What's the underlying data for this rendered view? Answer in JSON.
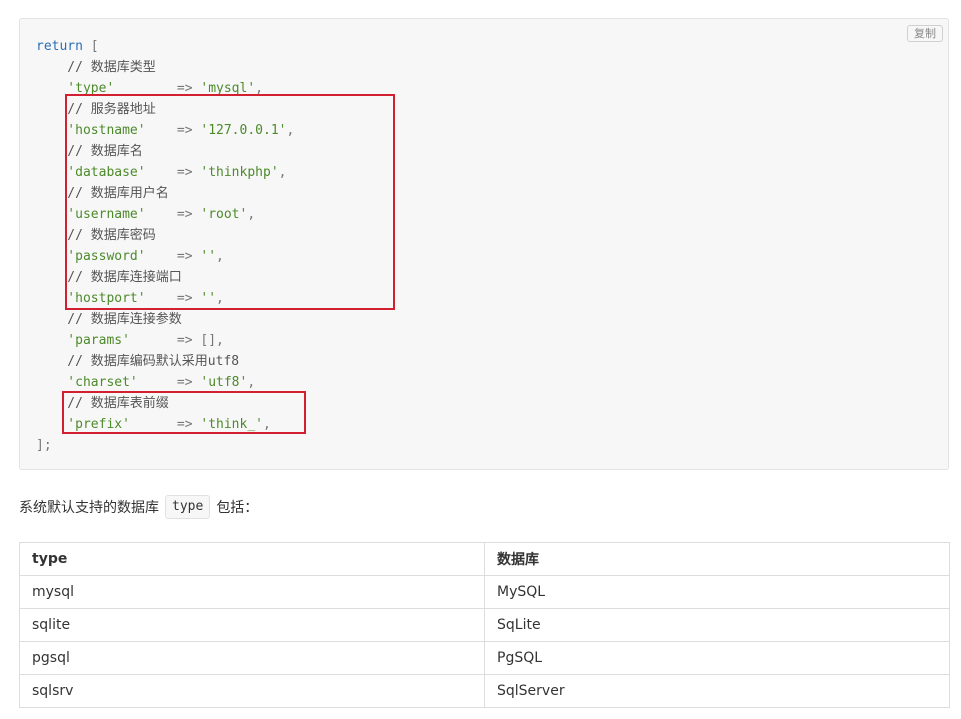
{
  "code_block": {
    "copy_label": "复制",
    "lines": [
      [
        {
          "c": "kw",
          "t": "return"
        },
        {
          "c": "pn",
          "t": " ["
        }
      ],
      [
        {
          "c": "cm",
          "t": "    // 数据库类型"
        }
      ],
      [
        {
          "c": "st",
          "t": "    'type'"
        },
        {
          "c": "pn",
          "t": "        => "
        },
        {
          "c": "st",
          "t": "'mysql'"
        },
        {
          "c": "pn",
          "t": ","
        }
      ],
      [
        {
          "c": "cm",
          "t": "    // 服务器地址"
        }
      ],
      [
        {
          "c": "st",
          "t": "    'hostname'"
        },
        {
          "c": "pn",
          "t": "    => "
        },
        {
          "c": "st",
          "t": "'127.0.0.1'"
        },
        {
          "c": "pn",
          "t": ","
        }
      ],
      [
        {
          "c": "cm",
          "t": "    // 数据库名"
        }
      ],
      [
        {
          "c": "st",
          "t": "    'database'"
        },
        {
          "c": "pn",
          "t": "    => "
        },
        {
          "c": "st",
          "t": "'thinkphp'"
        },
        {
          "c": "pn",
          "t": ","
        }
      ],
      [
        {
          "c": "cm",
          "t": "    // 数据库用户名"
        }
      ],
      [
        {
          "c": "st",
          "t": "    'username'"
        },
        {
          "c": "pn",
          "t": "    => "
        },
        {
          "c": "st",
          "t": "'root'"
        },
        {
          "c": "pn",
          "t": ","
        }
      ],
      [
        {
          "c": "cm",
          "t": "    // 数据库密码"
        }
      ],
      [
        {
          "c": "st",
          "t": "    'password'"
        },
        {
          "c": "pn",
          "t": "    => "
        },
        {
          "c": "st",
          "t": "''"
        },
        {
          "c": "pn",
          "t": ","
        }
      ],
      [
        {
          "c": "cm",
          "t": "    // 数据库连接端口"
        }
      ],
      [
        {
          "c": "st",
          "t": "    'hostport'"
        },
        {
          "c": "pn",
          "t": "    => "
        },
        {
          "c": "st",
          "t": "''"
        },
        {
          "c": "pn",
          "t": ","
        }
      ],
      [
        {
          "c": "cm",
          "t": "    // 数据库连接参数"
        }
      ],
      [
        {
          "c": "st",
          "t": "    'params'"
        },
        {
          "c": "pn",
          "t": "      => [],"
        }
      ],
      [
        {
          "c": "cm",
          "t": "    // 数据库编码默认采用utf8"
        }
      ],
      [
        {
          "c": "st",
          "t": "    'charset'"
        },
        {
          "c": "pn",
          "t": "     => "
        },
        {
          "c": "st",
          "t": "'utf8'"
        },
        {
          "c": "pn",
          "t": ","
        }
      ],
      [
        {
          "c": "cm",
          "t": "    // 数据库表前缀"
        }
      ],
      [
        {
          "c": "st",
          "t": "    'prefix'"
        },
        {
          "c": "pn",
          "t": "      => "
        },
        {
          "c": "st",
          "t": "'think_'"
        },
        {
          "c": "pn",
          "t": ","
        }
      ],
      [
        {
          "c": "pn",
          "t": "];"
        }
      ]
    ],
    "highlight_color": "#d32030"
  },
  "intro": {
    "before": "系统默认支持的数据库",
    "code": "type",
    "after": "包括："
  },
  "table": {
    "headers": [
      "type",
      "数据库"
    ],
    "rows": [
      [
        "mysql",
        "MySQL"
      ],
      [
        "sqlite",
        "SqLite"
      ],
      [
        "pgsql",
        "PgSQL"
      ],
      [
        "sqlsrv",
        "SqlServer"
      ]
    ]
  }
}
